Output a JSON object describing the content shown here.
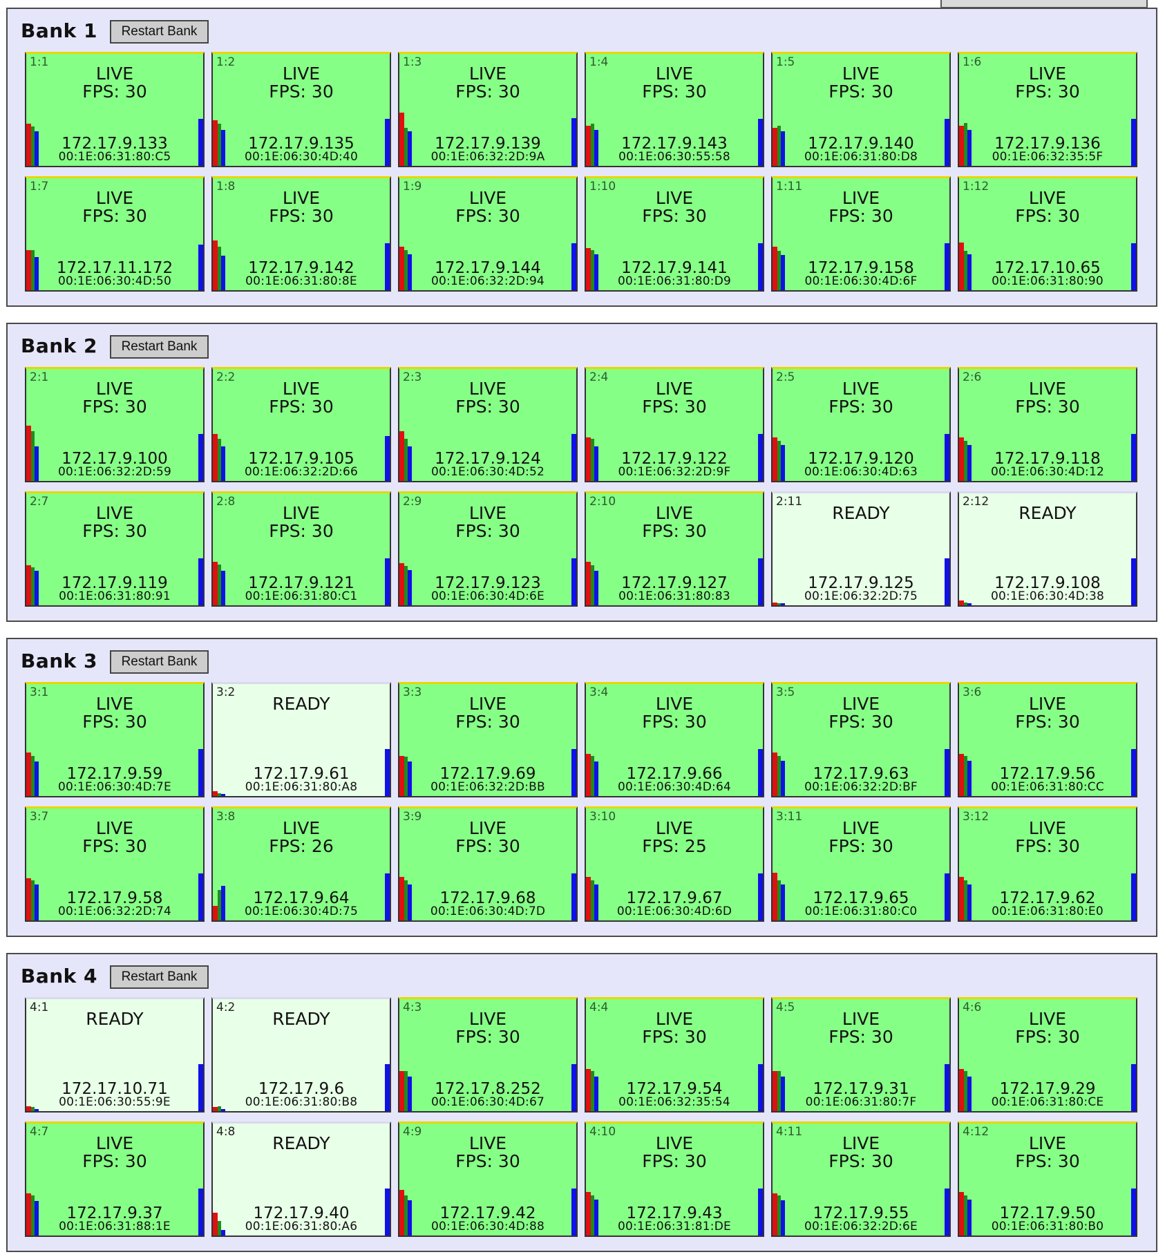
{
  "banks": [
    {
      "title": "Bank 1",
      "restart_label": "Restart Bank",
      "tiles": [
        {
          "id": "1:1",
          "status": "LIVE",
          "fps": "FPS: 30",
          "ip": "172.17.9.133",
          "mac": "00:1E:06:31:80:C5",
          "level_red": 0.44,
          "level_green": 0.41,
          "level_blue": 0.36,
          "level_right": 0.49
        },
        {
          "id": "1:2",
          "status": "LIVE",
          "fps": "FPS: 30",
          "ip": "172.17.9.135",
          "mac": "00:1E:06:30:4D:40",
          "level_red": 0.48,
          "level_green": 0.44,
          "level_blue": 0.38,
          "level_right": 0.49
        },
        {
          "id": "1:3",
          "status": "LIVE",
          "fps": "FPS: 30",
          "ip": "172.17.9.139",
          "mac": "00:1E:06:32:2D:9A",
          "level_red": 0.46,
          "level_green": 0.42,
          "level_blue": 0.36,
          "level_right": 0.49
        },
        {
          "id": "1:4",
          "status": "LIVE",
          "fps": "FPS: 30",
          "ip": "172.17.9.143",
          "mac": "00:1E:06:30:55:58",
          "level_red": 0.42,
          "level_green": 0.43,
          "level_blue": 0.38,
          "level_right": 0.49
        },
        {
          "id": "1:5",
          "status": "LIVE",
          "fps": "FPS: 30",
          "ip": "172.17.9.140",
          "mac": "00:1E:06:31:80:D8",
          "level_red": 0.4,
          "level_green": 0.41,
          "level_blue": 0.36,
          "level_right": 0.49
        },
        {
          "id": "1:6",
          "status": "LIVE",
          "fps": "FPS: 30",
          "ip": "172.17.9.136",
          "mac": "00:1E:06:32:35:5F",
          "level_red": 0.42,
          "level_green": 0.45,
          "level_blue": 0.38,
          "level_right": 0.49
        }
      ]
    }
  ],
  "extra": []
}
